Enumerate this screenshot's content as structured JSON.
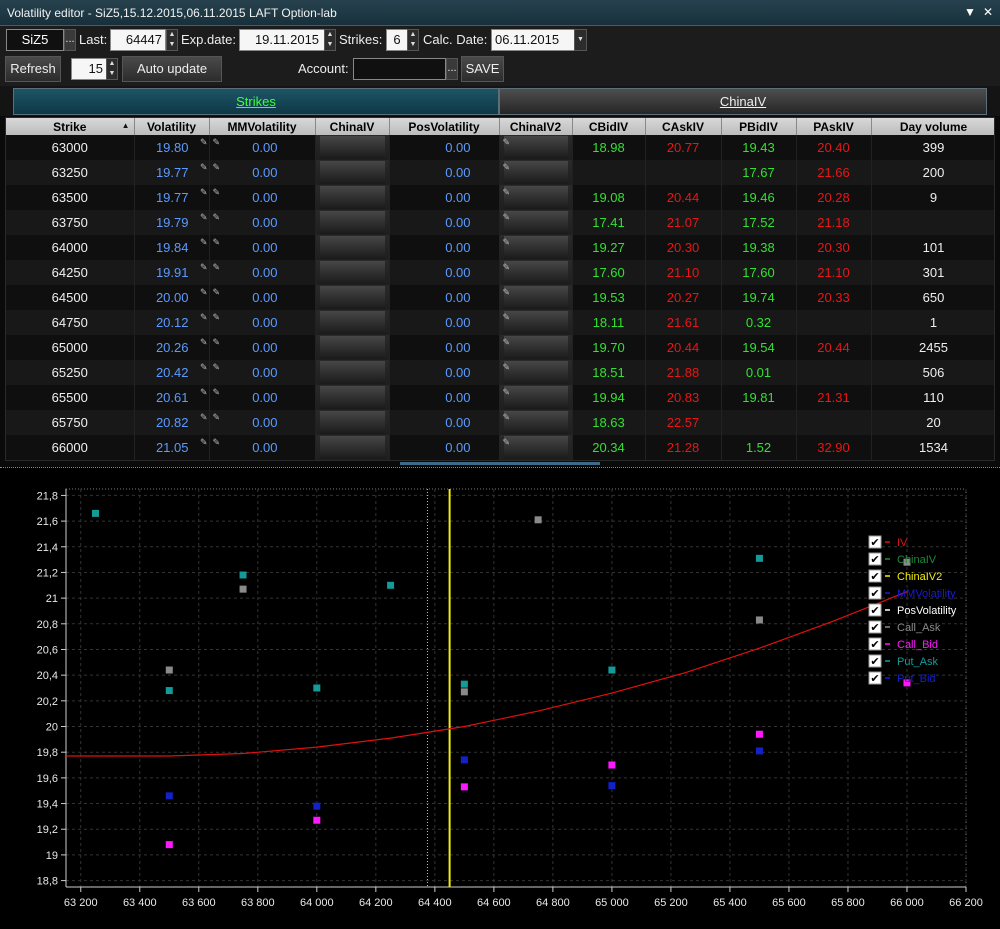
{
  "window": {
    "title": "Volatility editor - SiZ5,15.12.2015,06.11.2015 LAFT Option-lab",
    "dropdown_icon": "▼",
    "close_icon": "✕"
  },
  "toolbar": {
    "symbol": "SiZ5",
    "dots": "...",
    "last_label": "Last:",
    "last_value": "64447",
    "exp_label": "Exp.date:",
    "exp_value": "19.11.2015",
    "strikes_label": "Strikes:",
    "strikes_value": "6",
    "calc_label": "Calc. Date:",
    "calc_value": "06.11.2015",
    "refresh_label": "Refresh",
    "interval_value": "15",
    "auto_update_label": "Auto update",
    "account_label": "Account:",
    "account_value": "",
    "save_label": "SAVE"
  },
  "tabs": [
    {
      "label": "Strikes",
      "active": true
    },
    {
      "label": "ChinaIV",
      "active": false
    }
  ],
  "table": {
    "columns": [
      "Strike",
      "Volatility",
      "MMVolatility",
      "ChinaIV",
      "PosVolatility",
      "ChinaIV2",
      "CBidIV",
      "CAskIV",
      "PBidIV",
      "PAskIV",
      "Day volume"
    ],
    "rows": [
      [
        "63000",
        "19.80",
        "0.00",
        "",
        "0.00",
        "",
        "18.98",
        "20.77",
        "19.43",
        "20.40",
        "399"
      ],
      [
        "63250",
        "19.77",
        "0.00",
        "",
        "0.00",
        "",
        "",
        "",
        "17.67",
        "21.66",
        "200"
      ],
      [
        "63500",
        "19.77",
        "0.00",
        "",
        "0.00",
        "",
        "19.08",
        "20.44",
        "19.46",
        "20.28",
        "9"
      ],
      [
        "63750",
        "19.79",
        "0.00",
        "",
        "0.00",
        "",
        "17.41",
        "21.07",
        "17.52",
        "21.18",
        ""
      ],
      [
        "64000",
        "19.84",
        "0.00",
        "",
        "0.00",
        "",
        "19.27",
        "20.30",
        "19.38",
        "20.30",
        "101"
      ],
      [
        "64250",
        "19.91",
        "0.00",
        "",
        "0.00",
        "",
        "17.60",
        "21.10",
        "17.60",
        "21.10",
        "301"
      ],
      [
        "64500",
        "20.00",
        "0.00",
        "",
        "0.00",
        "",
        "19.53",
        "20.27",
        "19.74",
        "20.33",
        "650"
      ],
      [
        "64750",
        "20.12",
        "0.00",
        "",
        "0.00",
        "",
        "18.11",
        "21.61",
        "0.32",
        "",
        "1"
      ],
      [
        "65000",
        "20.26",
        "0.00",
        "",
        "0.00",
        "",
        "19.70",
        "20.44",
        "19.54",
        "20.44",
        "2455"
      ],
      [
        "65250",
        "20.42",
        "0.00",
        "",
        "0.00",
        "",
        "18.51",
        "21.88",
        "0.01",
        "",
        "506"
      ],
      [
        "65500",
        "20.61",
        "0.00",
        "",
        "0.00",
        "",
        "19.94",
        "20.83",
        "19.81",
        "21.31",
        "110"
      ],
      [
        "65750",
        "20.82",
        "0.00",
        "",
        "0.00",
        "",
        "18.63",
        "22.57",
        "",
        "",
        "20"
      ],
      [
        "66000",
        "21.05",
        "0.00",
        "",
        "0.00",
        "",
        "20.34",
        "21.28",
        "1.52",
        "32.90",
        "1534"
      ]
    ]
  },
  "chart_data": {
    "type": "scatter",
    "xlim": [
      63150,
      66200
    ],
    "ylim": [
      18.75,
      21.85
    ],
    "x_ticks": [
      "63 200",
      "63 400",
      "63 600",
      "63 800",
      "64 000",
      "64 200",
      "64 400",
      "64 600",
      "64 800",
      "65 000",
      "65 200",
      "65 400",
      "65 600",
      "65 800",
      "66 000",
      "66 200"
    ],
    "x_tick_values": [
      63200,
      63400,
      63600,
      63800,
      64000,
      64200,
      64400,
      64600,
      64800,
      65000,
      65200,
      65400,
      65600,
      65800,
      66000,
      66200
    ],
    "y_ticks": [
      "18,8",
      "19",
      "19,2",
      "19,4",
      "19,6",
      "19,8",
      "20",
      "20,2",
      "20,4",
      "20,6",
      "20,8",
      "21",
      "21,2",
      "21,4",
      "21,6",
      "21,8"
    ],
    "y_tick_values": [
      18.8,
      19.0,
      19.2,
      19.4,
      19.6,
      19.8,
      20.0,
      20.2,
      20.4,
      20.6,
      20.8,
      21.0,
      21.2,
      21.4,
      21.6,
      21.8
    ],
    "grid": true,
    "vertical_lines": [
      {
        "x": 64450,
        "color": "#f2ee0a"
      },
      {
        "x": 64375,
        "color": "#bbbbbb"
      }
    ],
    "legend_position": "right",
    "series": [
      {
        "name": "IV",
        "color": "#e01010",
        "kind": "line",
        "x": [
          63150,
          63500,
          63750,
          64000,
          64250,
          64500,
          64750,
          65000,
          65250,
          65500,
          65750,
          66000
        ],
        "y": [
          19.77,
          19.77,
          19.79,
          19.84,
          19.91,
          20.0,
          20.12,
          20.26,
          20.42,
          20.61,
          20.82,
          21.05
        ]
      },
      {
        "name": "ChinaIV",
        "color": "#1e8a3a",
        "kind": "line",
        "x": [],
        "y": []
      },
      {
        "name": "ChinaIV2",
        "color": "#f2ee0a",
        "kind": "line",
        "x": [],
        "y": []
      },
      {
        "name": "MMVolatility",
        "color": "#1a1ad8",
        "kind": "line",
        "x": [],
        "y": []
      },
      {
        "name": "PosVolatility",
        "color": "#ffffff",
        "kind": "line",
        "x": [],
        "y": []
      },
      {
        "name": "Call_Ask",
        "color": "#8a8a8a",
        "kind": "points",
        "x": [
          63500,
          63750,
          64500,
          64750,
          65250,
          65500,
          66000
        ],
        "y": [
          20.44,
          21.07,
          20.27,
          21.61,
          21.88,
          20.83,
          21.28
        ]
      },
      {
        "name": "Call_Bid",
        "color": "#ff18ff",
        "kind": "points",
        "x": [
          63500,
          64000,
          64500,
          65000,
          65500,
          66000
        ],
        "y": [
          19.08,
          19.27,
          19.53,
          19.7,
          19.94,
          20.34
        ]
      },
      {
        "name": "Put_Ask",
        "color": "#159a9a",
        "kind": "points",
        "x": [
          63250,
          63500,
          63750,
          64000,
          64250,
          64500,
          65000,
          65500
        ],
        "y": [
          21.66,
          20.28,
          21.18,
          20.3,
          21.1,
          20.33,
          20.44,
          21.31
        ]
      },
      {
        "name": "Put_Bid",
        "color": "#1420c8",
        "kind": "points",
        "x": [
          63500,
          64000,
          64500,
          65000,
          65500
        ],
        "y": [
          19.46,
          19.38,
          19.74,
          19.54,
          19.81
        ]
      }
    ]
  }
}
